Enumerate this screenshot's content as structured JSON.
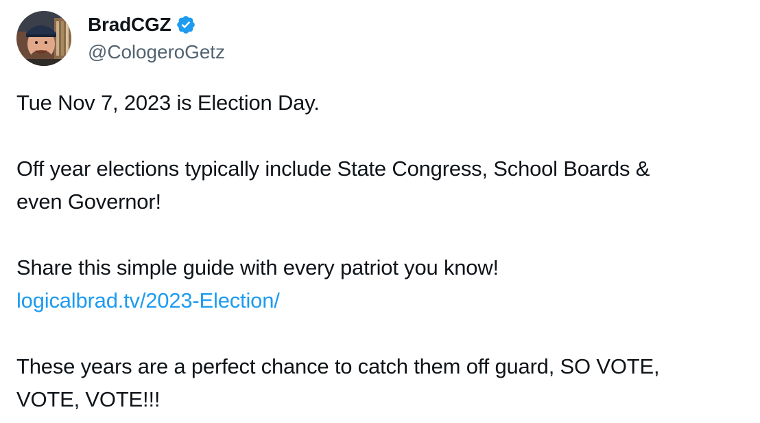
{
  "author": {
    "display_name": "BradCGZ",
    "handle": "@CologeroGetz",
    "verified_icon": "verified-badge-icon",
    "accent_color": "#1d9bf0"
  },
  "tweet": {
    "line1": "Tue Nov 7, 2023 is Election Day.",
    "line2a": "Off year elections typically include State Congress, School Boards &",
    "line2b": "even Governor!",
    "line3": "Share this simple guide with every patriot you know!",
    "link_text": "logicalbrad.tv/2023-Election/",
    "line4a": "These years are a perfect chance to catch them off guard, SO VOTE,",
    "line4b": "VOTE, VOTE!!!"
  }
}
